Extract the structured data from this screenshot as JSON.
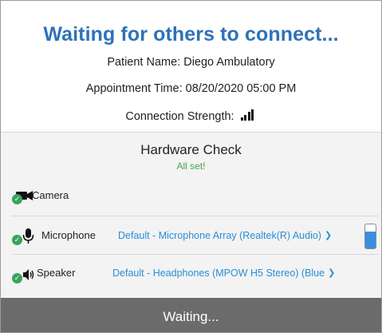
{
  "header": {
    "title": "Waiting for others to connect...",
    "patient_name": "Patient Name: Diego Ambulatory",
    "appointment_time": "Appointment Time: 08/20/2020 05:00 PM",
    "connection_strength_label": "Connection Strength:",
    "connection_strength_bars": 4,
    "signal_icon": "signal-bars-icon"
  },
  "hardware_check": {
    "title": "Hardware Check",
    "status": "All set!",
    "status_color": "#48a44a",
    "devices": {
      "camera": {
        "label": "Camera",
        "icon": "camera-icon",
        "check_icon": "checkmark-icon"
      },
      "microphone": {
        "label": "Microphone",
        "icon": "microphone-icon",
        "check_icon": "checkmark-icon",
        "selected": "Default - Microphone Array (Realtek(R) Audio)",
        "level": 0.7
      },
      "speaker": {
        "label": "Speaker",
        "icon": "speaker-icon",
        "check_icon": "checkmark-icon",
        "selected": "Default - Headphones (MPOW H5 Stereo) (Blue"
      }
    }
  },
  "footer": {
    "waiting_label": "Waiting..."
  },
  "colors": {
    "title": "#2e72b8",
    "link": "#2a8ed6",
    "footer_bg": "#6b6b6b",
    "panel_bg": "#f3f3f3",
    "check": "#3aa35b",
    "level_fill": "#3a8ee0"
  }
}
